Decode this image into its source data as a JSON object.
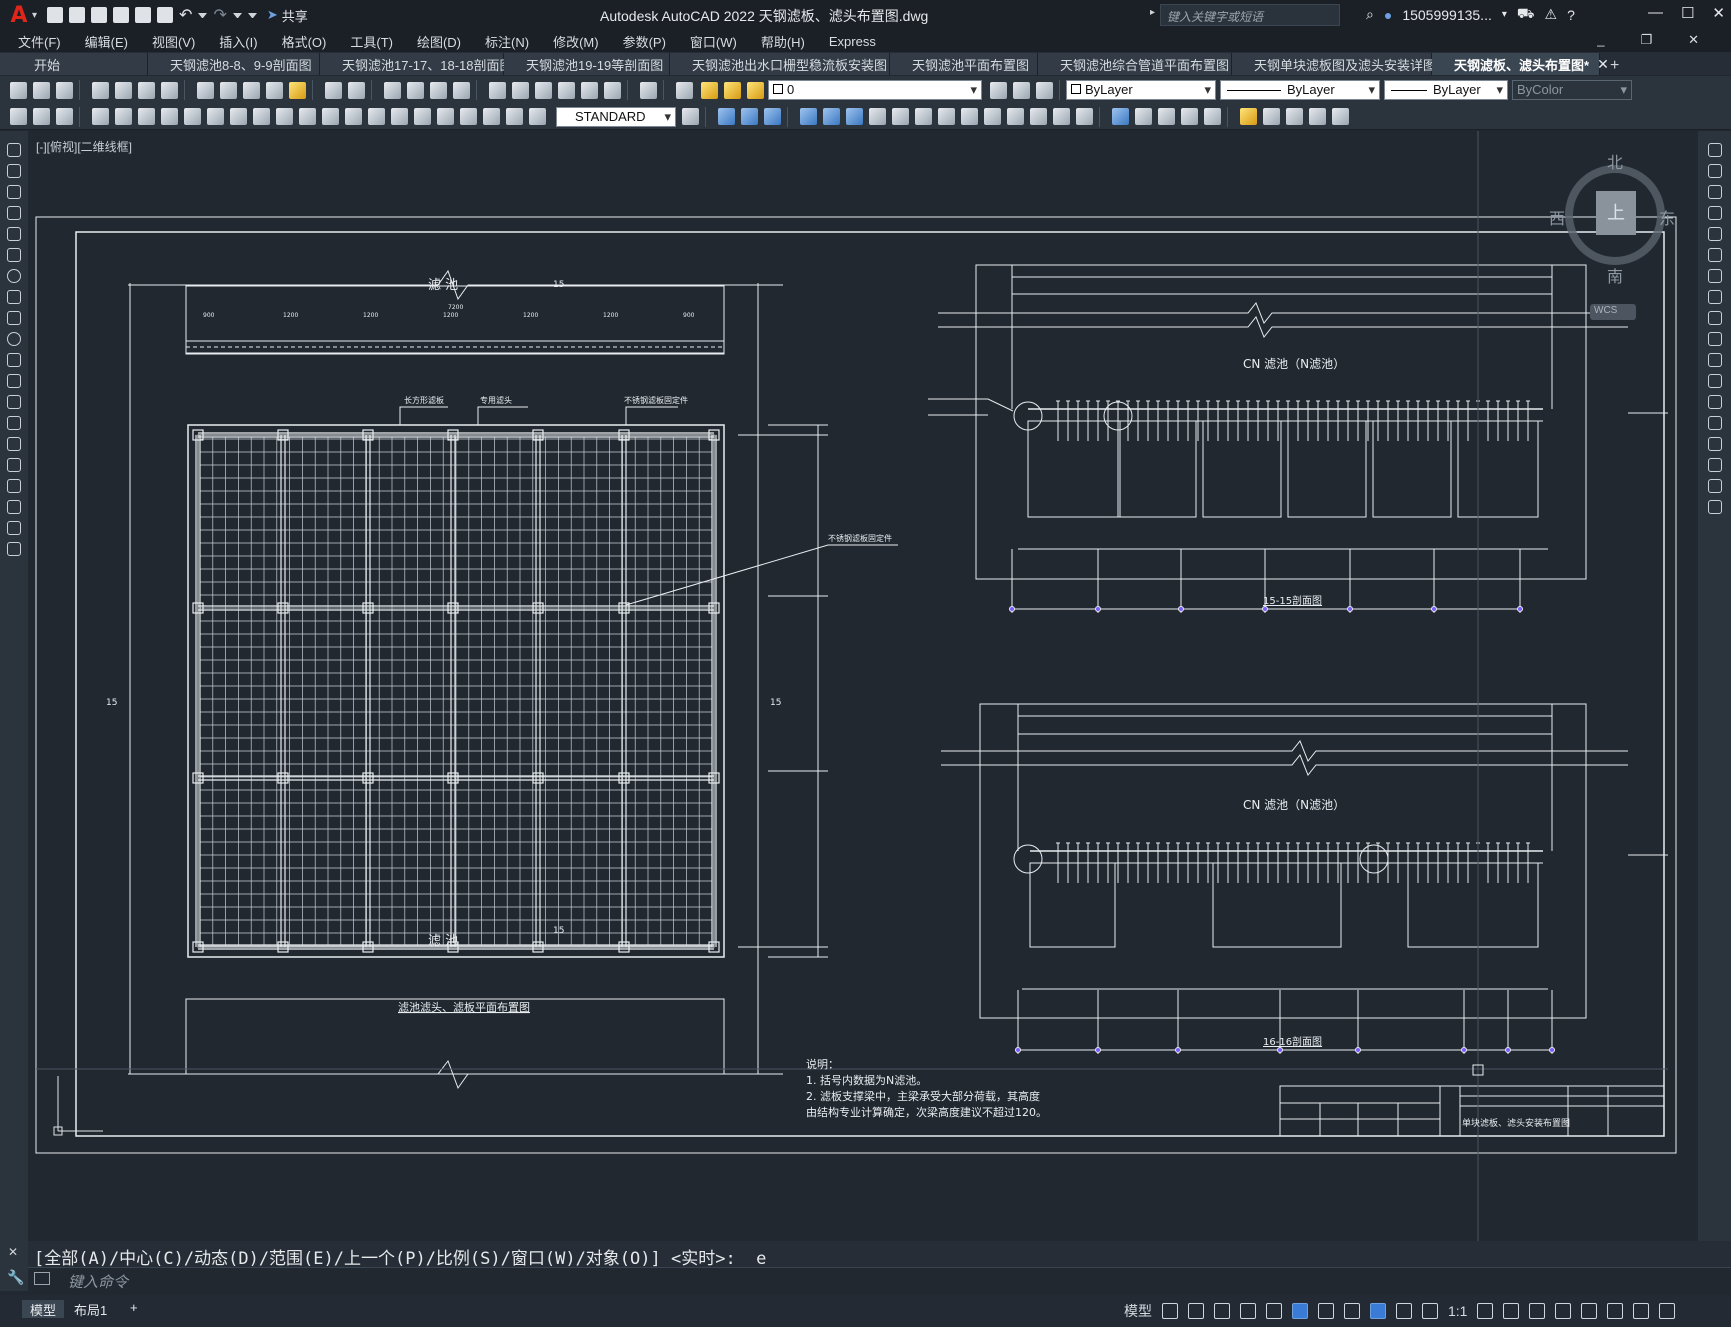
{
  "titlebar": {
    "logo": "A",
    "share_label": "共享",
    "title": "Autodesk AutoCAD 2022    天钢滤板、滤头布置图.dwg",
    "search_placeholder": "键入关键字或短语",
    "user": "1505999135...",
    "min": "—",
    "max": "☐",
    "close": "✕"
  },
  "menu": {
    "items": [
      "文件(F)",
      "编辑(E)",
      "视图(V)",
      "插入(I)",
      "格式(O)",
      "工具(T)",
      "绘图(D)",
      "标注(N)",
      "修改(M)",
      "参数(P)",
      "窗口(W)",
      "帮助(H)",
      "Express"
    ]
  },
  "tabs": {
    "start": "开始",
    "items": [
      {
        "label": "天钢滤池8-8、9-9剖面图",
        "active": false
      },
      {
        "label": "天钢滤池17-17、18-18剖面图",
        "active": false
      },
      {
        "label": "天钢滤池19-19等剖面图",
        "active": false
      },
      {
        "label": "天钢滤池出水口栅型稳流板安装图",
        "active": false
      },
      {
        "label": "天钢滤池平面布置图",
        "active": false
      },
      {
        "label": "天钢滤池综合管道平面布置图",
        "active": false
      },
      {
        "label": "天钢单块滤板图及滤头安装详图",
        "active": false
      },
      {
        "label": "天钢滤板、滤头布置图*",
        "active": true
      }
    ],
    "close": "✕",
    "add": "+"
  },
  "toolbar": {
    "layer_value": "0",
    "color_value": "ByLayer",
    "linetype_value": "ByLayer",
    "lineweight_value": "ByLayer",
    "plotstyle_value": "ByColor",
    "textstyle_value": "STANDARD"
  },
  "viewport": {
    "label": "[-][俯视][二维线框]",
    "viewcube": {
      "n": "北",
      "s": "南",
      "e": "东",
      "w": "西",
      "top": "上",
      "wcs": "WCS"
    }
  },
  "drawing": {
    "pool_label": "滤  池",
    "section_mark": "15",
    "plan_title": "滤池滤头、滤板平面布置图",
    "callout_plate": "不锈钢滤板固定件",
    "callout_plate2": "不锈钢滤板固定件",
    "callout_nozzle": "专用滤头",
    "callout_board": "长方形滤板",
    "dim_top": "7200",
    "dims_top_row": [
      "900",
      "1200",
      "1200",
      "1200",
      "1200",
      "1200",
      "900"
    ],
    "section_a_title": "CN 滤池（N滤池）",
    "section_a_name": "15-15剖面图",
    "section_b_title": "CN 滤池（N滤池）",
    "section_b_name": "16-16剖面图",
    "section_mark_16": "16",
    "notes_title": "说明：",
    "notes": [
      "1. 括号内数据为N滤池。",
      "2. 滤板支撑梁中，主梁承受大部分荷载，其高度",
      "   由结构专业计算确定，次梁高度建议不超过120。"
    ],
    "title_block_name": "单块滤板、滤头安装布置图"
  },
  "command": {
    "history": "[全部(A)/中心(C)/动态(D)/范围(E)/上一个(P)/比例(S)/窗口(W)/对象(O)] <实时>: _e",
    "placeholder": "键入命令"
  },
  "status": {
    "model_tab": "模型",
    "layout_tab": "布局1",
    "add": "+",
    "model_label": "模型",
    "scale": "1:1"
  }
}
